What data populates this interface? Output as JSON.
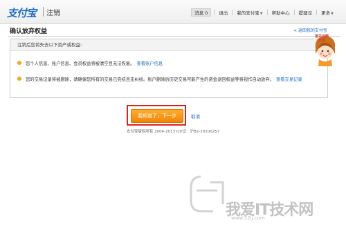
{
  "header": {
    "logo_text": "支付宝",
    "page_name": "注销",
    "nav": {
      "messages_label": "消息",
      "messages_count": "0",
      "logout": "退出",
      "my_alipay": "我的支付宝",
      "help_center": "帮助中心",
      "feedback": "提建议",
      "more": "更多"
    }
  },
  "main": {
    "title": "确认放弃权益",
    "back_link": "< 返回我的支付宝",
    "panel_heading": "注销后您将失去以下资产或权益:",
    "notices": [
      {
        "text": "您个人信息、账户信息、会员权益将被清空且无法恢复。",
        "link": "查看账户信息"
      },
      {
        "text": "您的交易记录将被删除，请确保您所有的交易已完结且无纠纷。账户删除后历史交易可能产生的资金退回权益等将视作自动放弃。",
        "link": "查看交易记录"
      }
    ],
    "confirm_button": "我知道了，下一步",
    "cancel_link": "取消",
    "footer": "支付宝版权所有 2004-2013 ICP证：沪B2-20100257"
  },
  "mascot": {
    "badge_text": "意见问题大客"
  },
  "watermark": {
    "text": "我爱IT技术网",
    "url": "www.52ij.com"
  }
}
